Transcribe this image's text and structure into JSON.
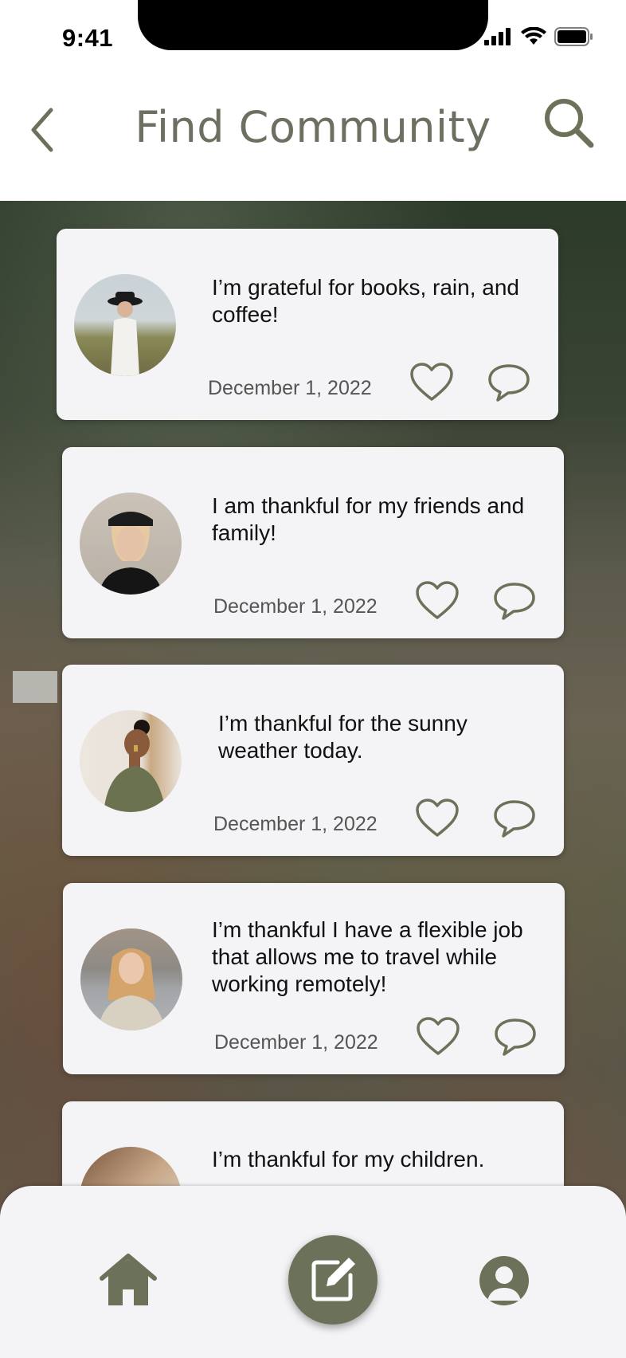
{
  "status_bar": {
    "time": "9:41"
  },
  "header": {
    "title": "Find Community"
  },
  "posts": [
    {
      "text": "I’m grateful for books, rain, and coffee!",
      "date": "December 1, 2022"
    },
    {
      "text": "I am thankful for my friends and family!",
      "date": "December 1, 2022"
    },
    {
      "text": "I’m thankful for the sunny weather today.",
      "date": "December 1, 2022"
    },
    {
      "text": "I’m thankful I have a flexible job that allows me to travel while working remotely!",
      "date": "December 1, 2022"
    },
    {
      "text": "I’m thankful for my children.",
      "date": ""
    }
  ],
  "colors": {
    "accent": "#6b7259",
    "title": "#6b7060",
    "card": "#f4f4f6"
  },
  "icons": {
    "back": "chevron-left-icon",
    "search": "search-icon",
    "like": "heart-icon",
    "comment": "speech-bubble-icon",
    "home": "home-icon",
    "compose": "compose-icon",
    "profile": "user-icon"
  }
}
